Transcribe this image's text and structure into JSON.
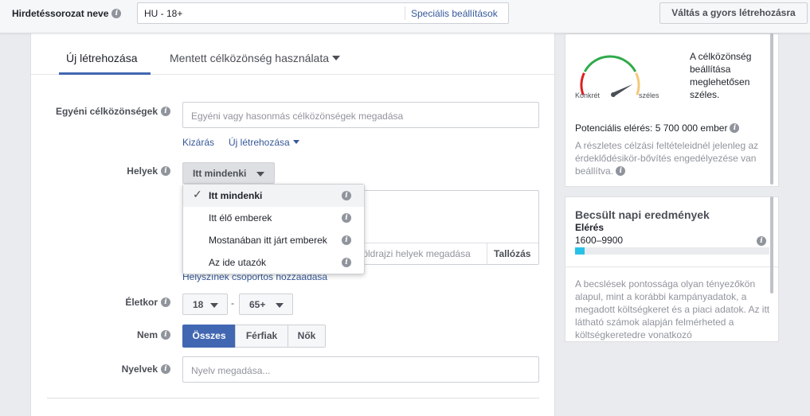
{
  "topbar": {
    "adset_label": "Hirdetéssorozat neve",
    "adset_name": "HU - 18+",
    "special_settings_link": "Speciális beállítások",
    "quick_create_button": "Váltás a gyors létrehozásra"
  },
  "tabs": {
    "new": "Új létrehozása",
    "saved": "Mentett célközönség használata"
  },
  "custom_audience": {
    "label": "Egyéni célközönségek",
    "placeholder": "Egyéni vagy hasonmás célközönségek megadása",
    "exclude_link": "Kizárás",
    "create_new_link": "Új létrehozása"
  },
  "locations": {
    "label": "Helyek",
    "selected": "Itt mindenki",
    "options": [
      {
        "label": "Itt mindenki",
        "selected": true
      },
      {
        "label": "Itt élő emberek",
        "selected": false
      },
      {
        "label": "Mostanában itt járt emberek",
        "selected": false
      },
      {
        "label": "Az ide utazók",
        "selected": false
      }
    ],
    "search_placeholder_fragment": "földrajzi helyek megadása",
    "browse_button": "Tallózás",
    "bulk_add_link": "Helyszínek csoportos hozzáadása"
  },
  "age": {
    "label": "Életkor",
    "min": "18",
    "max": "65+",
    "separator": "-"
  },
  "gender": {
    "label": "Nem",
    "options": [
      "Összes",
      "Férfiak",
      "Nők"
    ],
    "selected_index": 0
  },
  "languages": {
    "label": "Nyelvek",
    "placeholder": "Nyelv megadása..."
  },
  "audience_size": {
    "gauge_left_label": "Konkrét",
    "gauge_right_label": "széles",
    "description": "A célközönség beállítása meglehetősen széles.",
    "potential_reach": "Potenciális elérés: 5 700 000 ember",
    "note": "A részletes célzási feltételeidnél jelenleg az érdeklődésikör-bővítés engedélyezése van beállítva.",
    "gauge_level": 0.78
  },
  "daily_results": {
    "title": "Becsült napi eredmények",
    "metric": "Elérés",
    "range": "1600–9900",
    "bar_fraction": 0.05,
    "disclaimer": "A becslések pontossága olyan tényezőkön alapul, mint a korábbi kampányadatok, a megadott költségkeret és a piaci adatok. Az itt látható számok alapján felmérheted a költségkeretedre vonatkozó"
  },
  "colors": {
    "accent": "#4267b2",
    "link": "#365899",
    "reach_bar": "#29c1e8",
    "gauge_red": "#e02020",
    "gauge_green": "#2eaa4a",
    "gauge_yellow": "#f5c87a"
  },
  "icons": [
    "info-icon",
    "caret-down-icon",
    "checkmark-icon",
    "gauge-needle-icon"
  ]
}
